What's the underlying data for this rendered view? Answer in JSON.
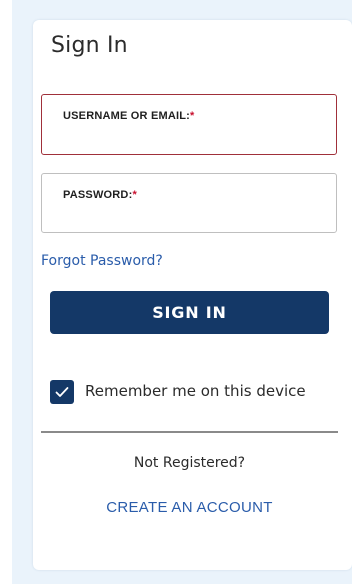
{
  "form": {
    "title": "Sign In",
    "username_label": "USERNAME OR EMAIL:",
    "password_label": "PASSWORD:",
    "required_marker": "*",
    "forgot_password": "Forgot Password?",
    "sign_in_button": "SIGN IN",
    "remember_me": {
      "label": "Remember me on this device",
      "checked": true
    },
    "not_registered": "Not Registered?",
    "create_account": "CREATE AN ACCOUNT"
  },
  "icons": {
    "checkbox": "checkmark-icon"
  },
  "colors": {
    "primary": "#143867",
    "link": "#2a5caa",
    "error_border": "#a0303a",
    "required": "#c8102e",
    "background_panel": "#eaf3fb"
  }
}
